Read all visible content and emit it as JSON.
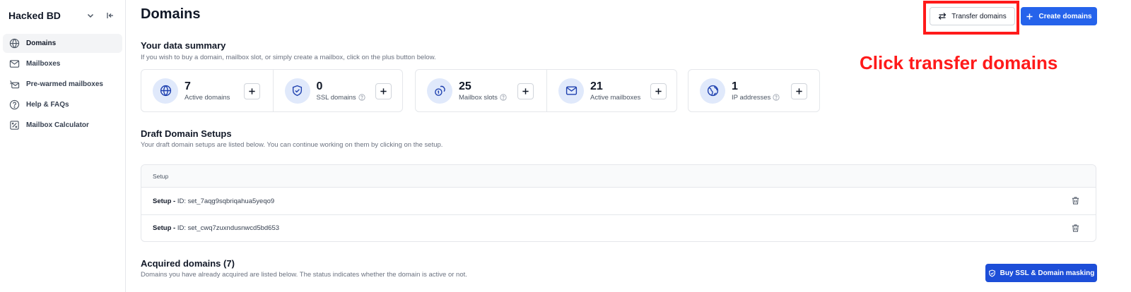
{
  "sidebar": {
    "workspace": "Hacked BD",
    "items": [
      {
        "label": "Domains",
        "icon": "globe-icon",
        "active": true
      },
      {
        "label": "Mailboxes",
        "icon": "mail-icon"
      },
      {
        "label": "Pre-warmed mailboxes",
        "icon": "prewarmed-icon"
      },
      {
        "label": "Help & FAQs",
        "icon": "help-circle-icon"
      },
      {
        "label": "Mailbox Calculator",
        "icon": "calculator-icon"
      }
    ]
  },
  "header": {
    "title": "Domains",
    "transfer_label": "Transfer domains",
    "create_label": "Create domains"
  },
  "annotation": {
    "text": "Click transfer domains",
    "color": "#ff1a1a"
  },
  "summary": {
    "title": "Your data summary",
    "subtitle": "If you wish to buy a domain, mailbox slot, or simply create a mailbox, click on the plus button below.",
    "stats": [
      {
        "value": "7",
        "label": "Active domains",
        "icon": "globe-icon"
      },
      {
        "value": "0",
        "label": "SSL domains",
        "icon": "shield-check-icon",
        "help": true
      },
      {
        "value": "25",
        "label": "Mailbox slots",
        "icon": "coins-icon",
        "help": true
      },
      {
        "value": "21",
        "label": "Active mailboxes",
        "icon": "mail-icon"
      },
      {
        "value": "1",
        "label": "IP addresses",
        "icon": "network-globe-icon",
        "help": true
      }
    ]
  },
  "drafts": {
    "title": "Draft Domain Setups",
    "subtitle": "Your draft domain setups are listed below. You can continue working on them by clicking on the setup.",
    "column": "Setup",
    "rows": [
      {
        "prefix": "Setup -",
        "text": " ID: set_7aqg9sqbriqahua5yeqo9"
      },
      {
        "prefix": "Setup -",
        "text": " ID: set_cwq7zuxndusnwcd5bd653"
      }
    ]
  },
  "acquired": {
    "title": "Acquired domains (7)",
    "subtitle": "Domains you have already acquired are listed below. The status indicates whether the domain is active or not.",
    "ssl_button": "Buy SSL & Domain masking"
  },
  "colors": {
    "primary": "#2563eb",
    "icon_bg": "#e0e9fb"
  }
}
